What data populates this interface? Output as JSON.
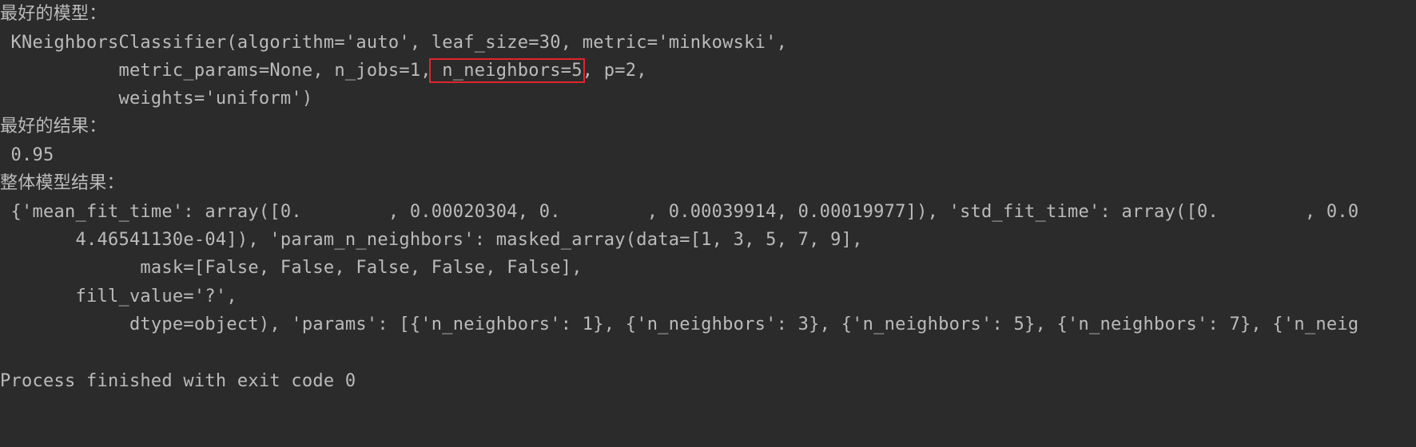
{
  "console": {
    "lines": [
      "最好的模型：",
      " KNeighborsClassifier(algorithm='auto', leaf_size=30, metric='minkowski',",
      "           metric_params=None, n_jobs=1,",
      "           weights='uniform')",
      "最好的结果：",
      " 0.95",
      "整体模型结果：",
      " {'mean_fit_time': array([0.        , 0.00020304, 0.        , 0.00039914, 0.00019977]), 'std_fit_time': array([0.        , 0.0",
      "       4.46541130e-04]), 'param_n_neighbors': masked_array(data=[1, 3, 5, 7, 9],",
      "             mask=[False, False, False, False, False],",
      "       fill_value='?',",
      "            dtype=object), 'params': [{'n_neighbors': 1}, {'n_neighbors': 3}, {'n_neighbors': 5}, {'n_neighbors': 7}, {'n_neig",
      "",
      "Process finished with exit code 0"
    ],
    "highlight": " n_neighbors=5",
    "after_highlight": ", p=2,",
    "highlight_color": "#e0252b"
  },
  "colors": {
    "background": "#2b2b2b",
    "text": "#bbbbbb"
  }
}
